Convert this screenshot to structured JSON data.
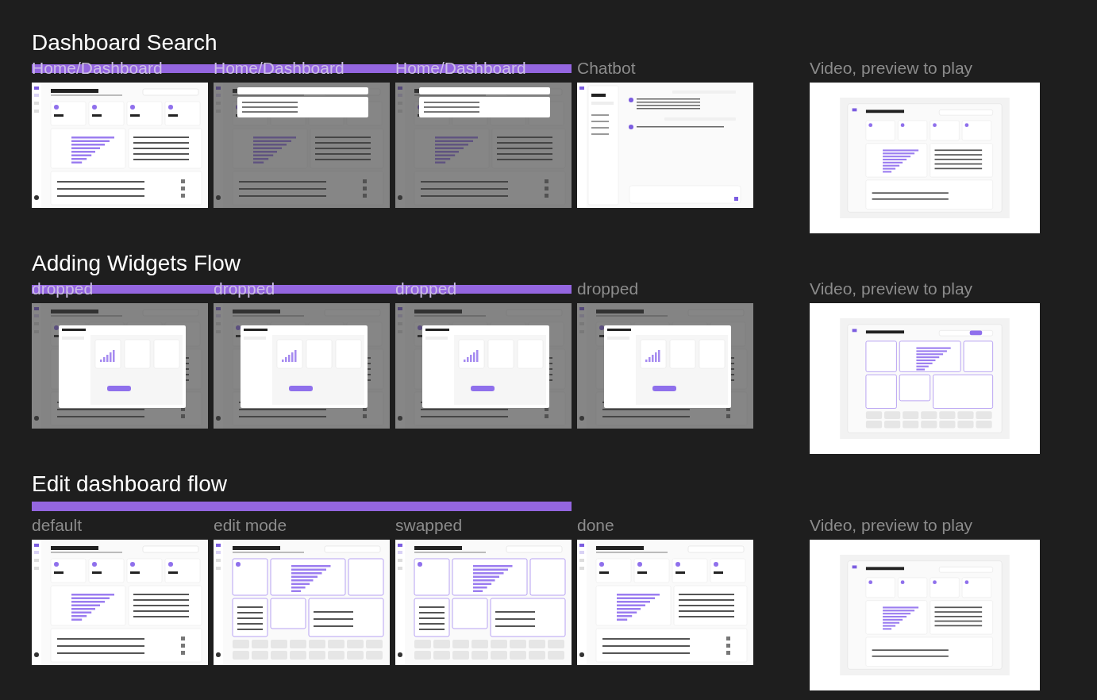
{
  "sections": [
    {
      "title": "Dashboard Search",
      "bar_above": false,
      "frames": [
        {
          "label": "Home/Dashboard",
          "barred": true,
          "kind": "dashboard",
          "dimmed": false
        },
        {
          "label": "Home/Dashboard",
          "barred": true,
          "kind": "search",
          "dimmed": true
        },
        {
          "label": "Home/Dashboard",
          "barred": true,
          "kind": "search",
          "dimmed": true
        },
        {
          "label": "Chatbot",
          "barred": false,
          "kind": "chatbot",
          "dimmed": false
        }
      ],
      "video": {
        "label": "Video, preview to play",
        "kind": "dashboard"
      }
    },
    {
      "title": "Adding Widgets Flow",
      "bar_above": false,
      "frames": [
        {
          "label": "dropped",
          "barred": true,
          "kind": "widgets",
          "dimmed": true
        },
        {
          "label": "dropped",
          "barred": true,
          "kind": "widgets",
          "dimmed": true
        },
        {
          "label": "dropped",
          "barred": true,
          "kind": "widgets",
          "dimmed": true
        },
        {
          "label": "dropped",
          "barred": false,
          "kind": "widgets",
          "dimmed": true
        }
      ],
      "video": {
        "label": "Video, preview to play",
        "kind": "edit"
      }
    },
    {
      "title": "Edit dashboard flow",
      "bar_above": true,
      "frames": [
        {
          "label": "default",
          "barred": true,
          "kind": "dashboard",
          "dimmed": false
        },
        {
          "label": "edit mode",
          "barred": true,
          "kind": "edit",
          "dimmed": false
        },
        {
          "label": "swapped",
          "barred": true,
          "kind": "edit",
          "dimmed": false
        },
        {
          "label": "done",
          "barred": false,
          "kind": "dashboard",
          "dimmed": false
        }
      ],
      "video": {
        "label": "Video, preview to play",
        "kind": "dashboard"
      }
    }
  ]
}
